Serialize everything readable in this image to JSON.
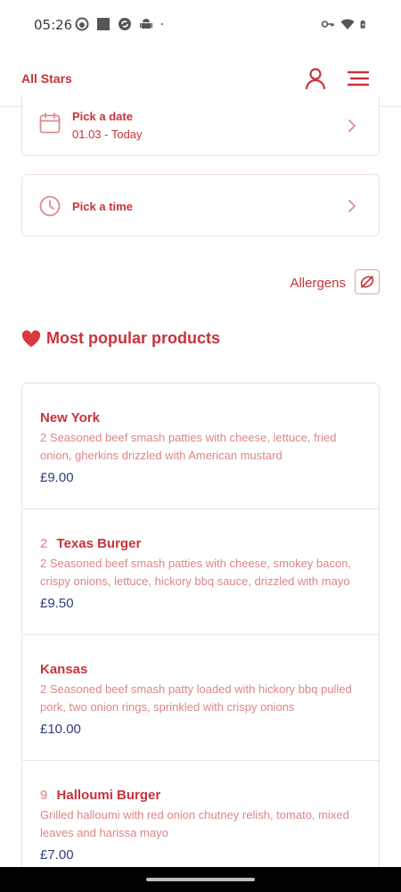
{
  "status_bar": {
    "time": "05:26",
    "left_icons": [
      "face-icon",
      "square-icon",
      "sync-icon",
      "android-icon",
      "dot-icon"
    ],
    "right_icons": [
      "key-icon",
      "wifi-icon",
      "battery-icon"
    ]
  },
  "app_bar": {
    "brand": "All Stars",
    "icons": [
      "user-icon",
      "menu-icon"
    ]
  },
  "date_picker": {
    "title": "Pick a date",
    "value": "01.03 - Today"
  },
  "time_picker": {
    "title": "Pick a time"
  },
  "allergens": {
    "label": "Allergens"
  },
  "popular": {
    "title": "Most popular products",
    "products": [
      {
        "badge": "",
        "name": "New York",
        "description": "2 Seasoned beef smash patties with cheese, lettuce, fried onion, gherkins drizzled with American mustard",
        "price": "£9.00"
      },
      {
        "badge": "2",
        "name": "Texas Burger",
        "description": "2 Seasoned beef smash patties with cheese, smokey bacon, crispy onions, lettuce, hickory bbq sauce, drizzled with mayo",
        "price": "£9.50"
      },
      {
        "badge": "",
        "name": "Kansas",
        "description": "2 Seasoned beef smash patty loaded with hickory bbq pulled pork, two onion rings, sprinkled with crispy onions",
        "price": "£10.00"
      },
      {
        "badge": "9",
        "name": "Halloumi Burger",
        "description": "Grilled halloumi with red onion chutney relish, tomato, mixed leaves and harissa mayo",
        "price": "£7.00"
      }
    ]
  },
  "colors": {
    "accent": "#c8343a",
    "description_text": "#dd8589",
    "price_text": "#2f3d7a",
    "border": "#f3dedf"
  }
}
